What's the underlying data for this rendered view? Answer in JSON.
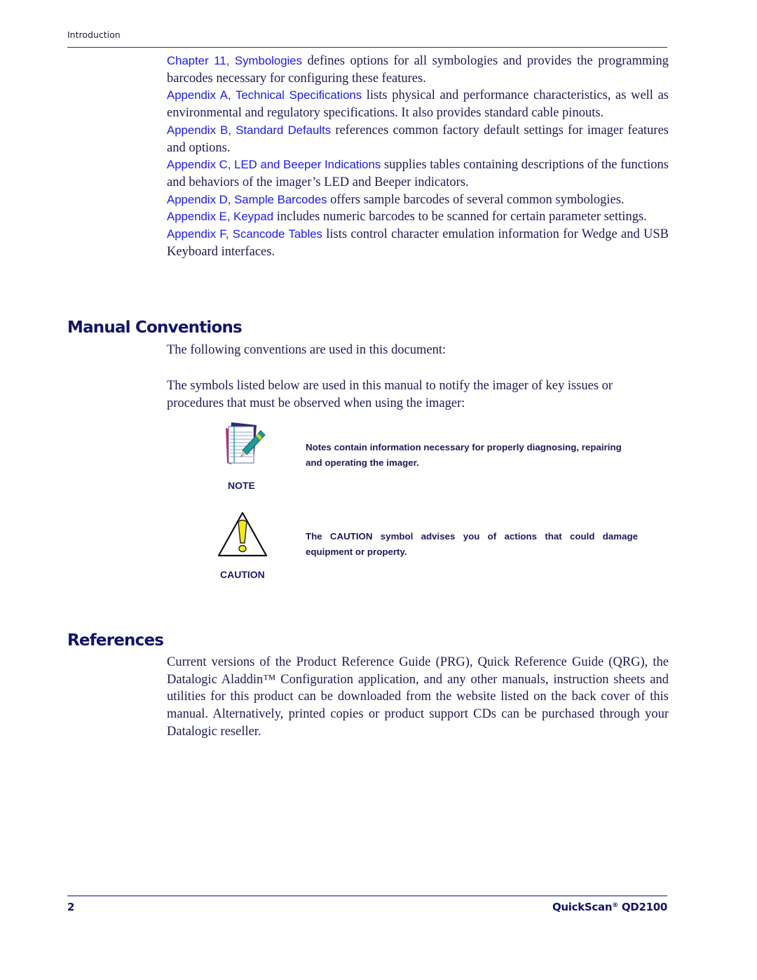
{
  "header": {
    "section": "Introduction"
  },
  "intro_items": [
    {
      "link": "Chapter 11, Symbologies",
      "text": " defines options for all symbologies and provides the program­ming barcodes necessary for configuring these features."
    },
    {
      "link": "Appendix A, Technical Specifications",
      "text": " lists physical and performance characteristics, as well as environmental and regulatory specifications. It also provides standard cable pin­outs."
    },
    {
      "link": "Appendix B, Standard Defaults",
      "text": " references common factory default settings for imager features and options."
    },
    {
      "link": "Appendix C, LED and Beeper Indications",
      "text": " supplies tables containing descriptions of the functions and behaviors of the imager’s LED and Beeper indicators."
    },
    {
      "link": "Appendix D, Sample Barcodes",
      "text": " offers sample barcodes of several common symbologies."
    },
    {
      "link": "Appendix E, Keypad",
      "text": " includes numeric barcodes to be scanned for certain parameter set­tings."
    },
    {
      "link": "Appendix F, Scancode Tables",
      "text": " lists control character emulation information for Wedge and USB Keyboard interfaces."
    }
  ],
  "conventions": {
    "heading": "Manual Conventions",
    "para1": "The following conventions are used in this document:",
    "para2": "The symbols listed below are used in this manual to notify the imager of key  issues or procedures that must be observed when using the imager:",
    "note": {
      "icon": "notepad-pen-icon",
      "label": "NOTE",
      "description": "Notes contain information necessary for properly diagnosing, repair­ing and operating the imager."
    },
    "caution": {
      "icon": "warning-triangle-icon",
      "label": "CAUTION",
      "description": "The CAUTION symbol advises you of actions that could damage equipment or property."
    }
  },
  "references": {
    "heading": "References",
    "para": "Current versions of the Product Reference Guide (PRG), Quick Reference Guide (QRG), the Datalogic Aladdin™ Configuration application, and any other manuals, in­struction sheets and utilities for this product can be downloaded from the website listed on the back cover of this manual. Alternatively, printed copies or product support CDs can be purchased through your Datalogic reseller."
  },
  "footer": {
    "page_number": "2",
    "product_name": "QuickScan",
    "registered": "®",
    "model": " QD2100"
  },
  "colors": {
    "link": "#1a1aee",
    "heading": "#12146a",
    "body_text": "#1b1b55",
    "rule": "#2b2f7a"
  }
}
